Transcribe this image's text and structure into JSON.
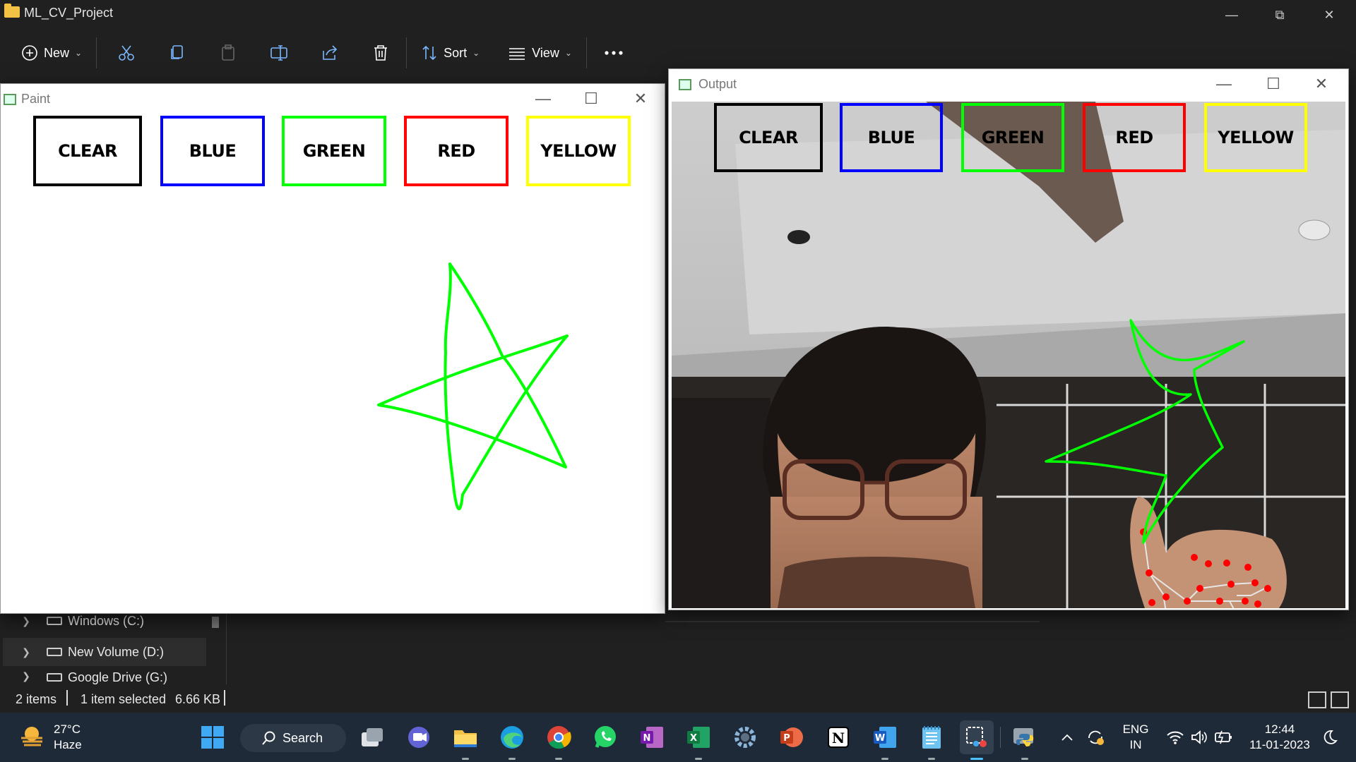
{
  "explorer": {
    "title": "ML_CV_Project",
    "toolbar": {
      "new_label": "New",
      "sort_label": "Sort",
      "view_label": "View"
    },
    "nav": [
      {
        "label": "Windows (C:)"
      },
      {
        "label": "New Volume (D:)"
      },
      {
        "label": "Google Drive (G:)"
      }
    ],
    "status": {
      "items": "2 items",
      "selected": "1 item selected",
      "size": "6.66 KB"
    }
  },
  "paint": {
    "title": "Paint",
    "buttons": [
      {
        "label": "CLEAR",
        "color": "#000000"
      },
      {
        "label": "BLUE",
        "color": "#0000ff"
      },
      {
        "label": "GREEN",
        "color": "#00ff00"
      },
      {
        "label": "RED",
        "color": "#ff0000"
      },
      {
        "label": "YELLOW",
        "color": "#ffff00"
      }
    ],
    "stroke_color": "#00ff00"
  },
  "output": {
    "title": "Output",
    "buttons": [
      {
        "label": "CLEAR",
        "color": "#000000"
      },
      {
        "label": "BLUE",
        "color": "#0000ff"
      },
      {
        "label": "GREEN",
        "color": "#00ff00"
      },
      {
        "label": "RED",
        "color": "#ff0000"
      },
      {
        "label": "YELLOW",
        "color": "#ffff00"
      }
    ]
  },
  "taskbar": {
    "weather_temp": "27°C",
    "weather_desc": "Haze",
    "search_label": "Search",
    "lang_1": "ENG",
    "lang_2": "IN",
    "time": "12:44",
    "date": "11-01-2023"
  }
}
